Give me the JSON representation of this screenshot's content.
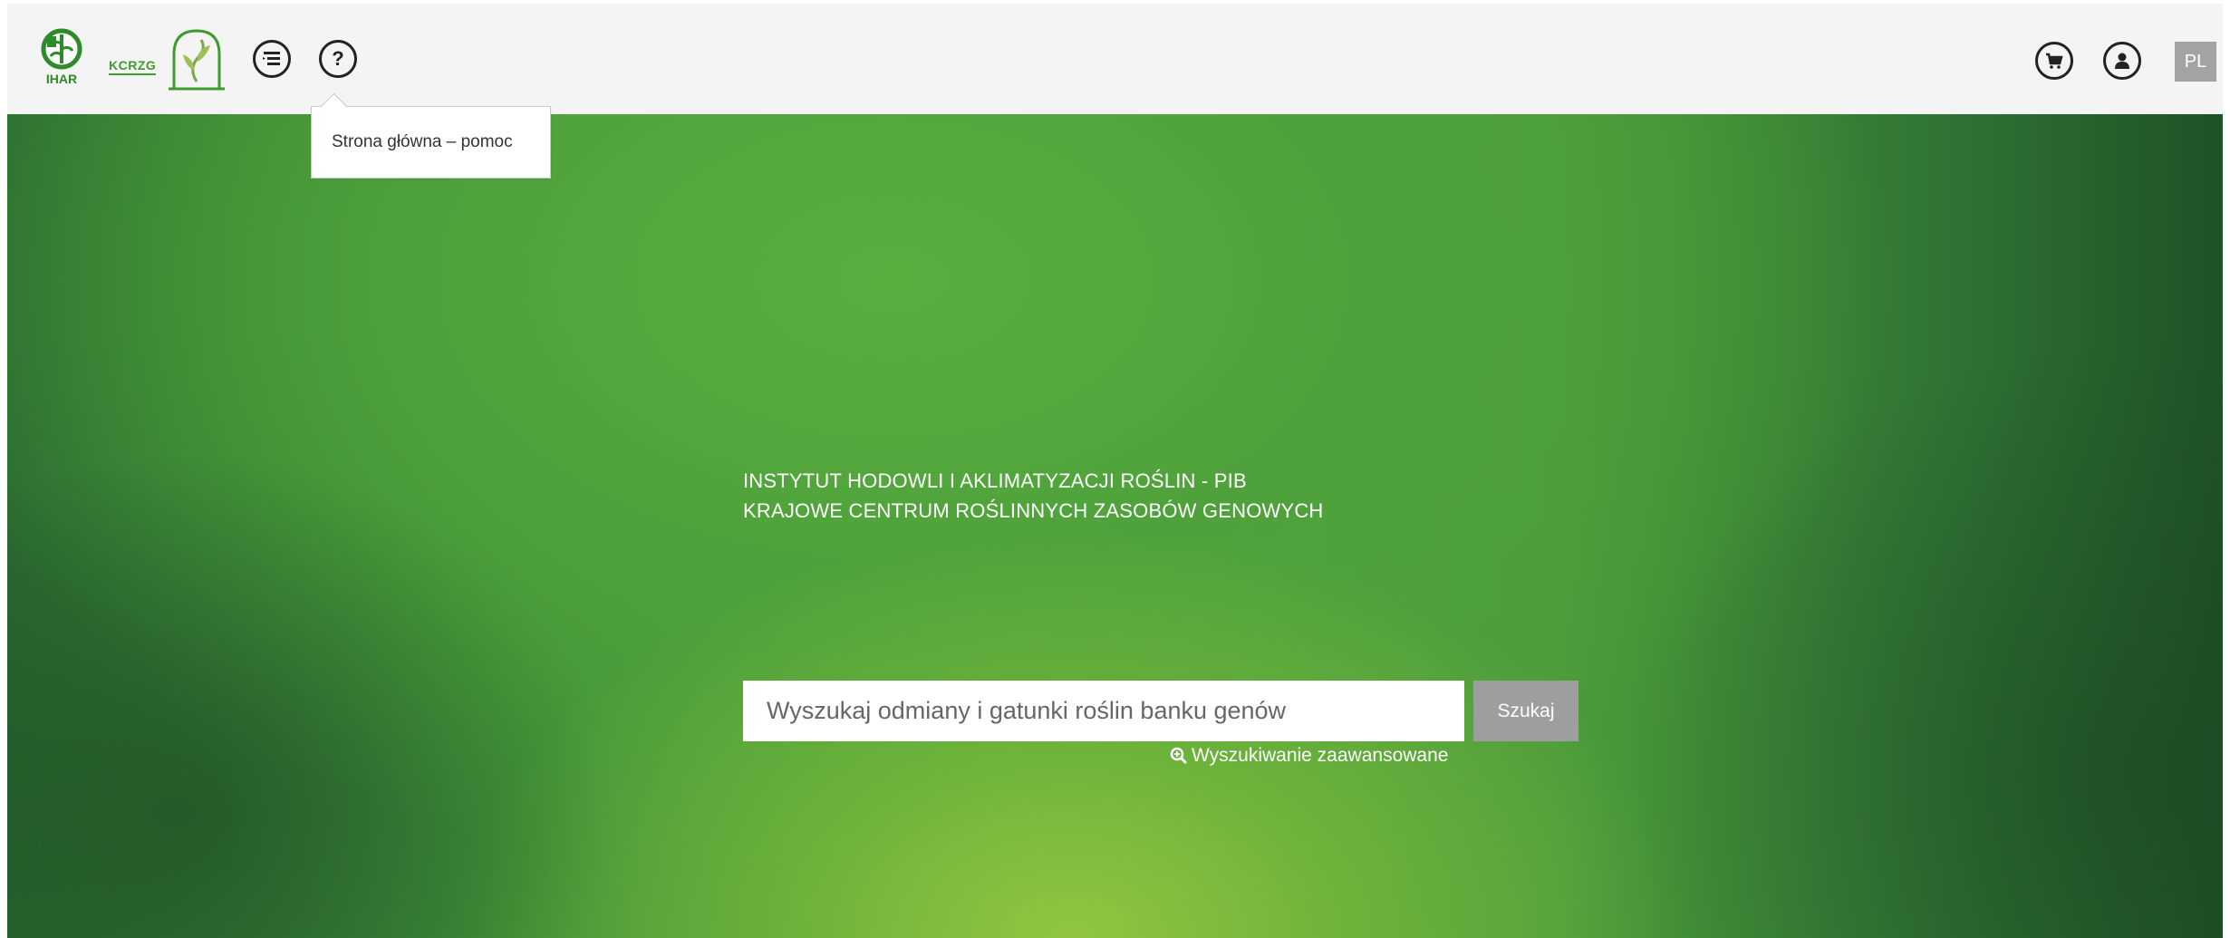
{
  "header": {
    "logo_ihar_label": "IHAR",
    "logo_kcrzg_label": "KCRZG",
    "help_symbol": "?",
    "language": "PL"
  },
  "tooltip": {
    "text": "Strona główna – pomoc"
  },
  "hero": {
    "title_line1": "INSTYTUT HODOWLI I AKLIMATYZACJI ROŚLIN - PIB",
    "title_line2": "KRAJOWE CENTRUM ROŚLINNYCH ZASOBÓW GENOWYCH"
  },
  "search": {
    "placeholder": "Wyszukaj odmiany i gatunki roślin banku genów",
    "button_label": "Szukaj",
    "advanced_link": "Wyszukiwanie zaawansowane"
  },
  "icons": {
    "menu": "menu-list-icon",
    "help": "question-icon",
    "cart": "cart-icon",
    "user": "user-icon",
    "advanced_search": "zoom-in-icon"
  },
  "colors": {
    "brand_green": "#3f9b2d",
    "header_bg": "#f4f4f4",
    "button_gray": "#9e9e9e"
  }
}
